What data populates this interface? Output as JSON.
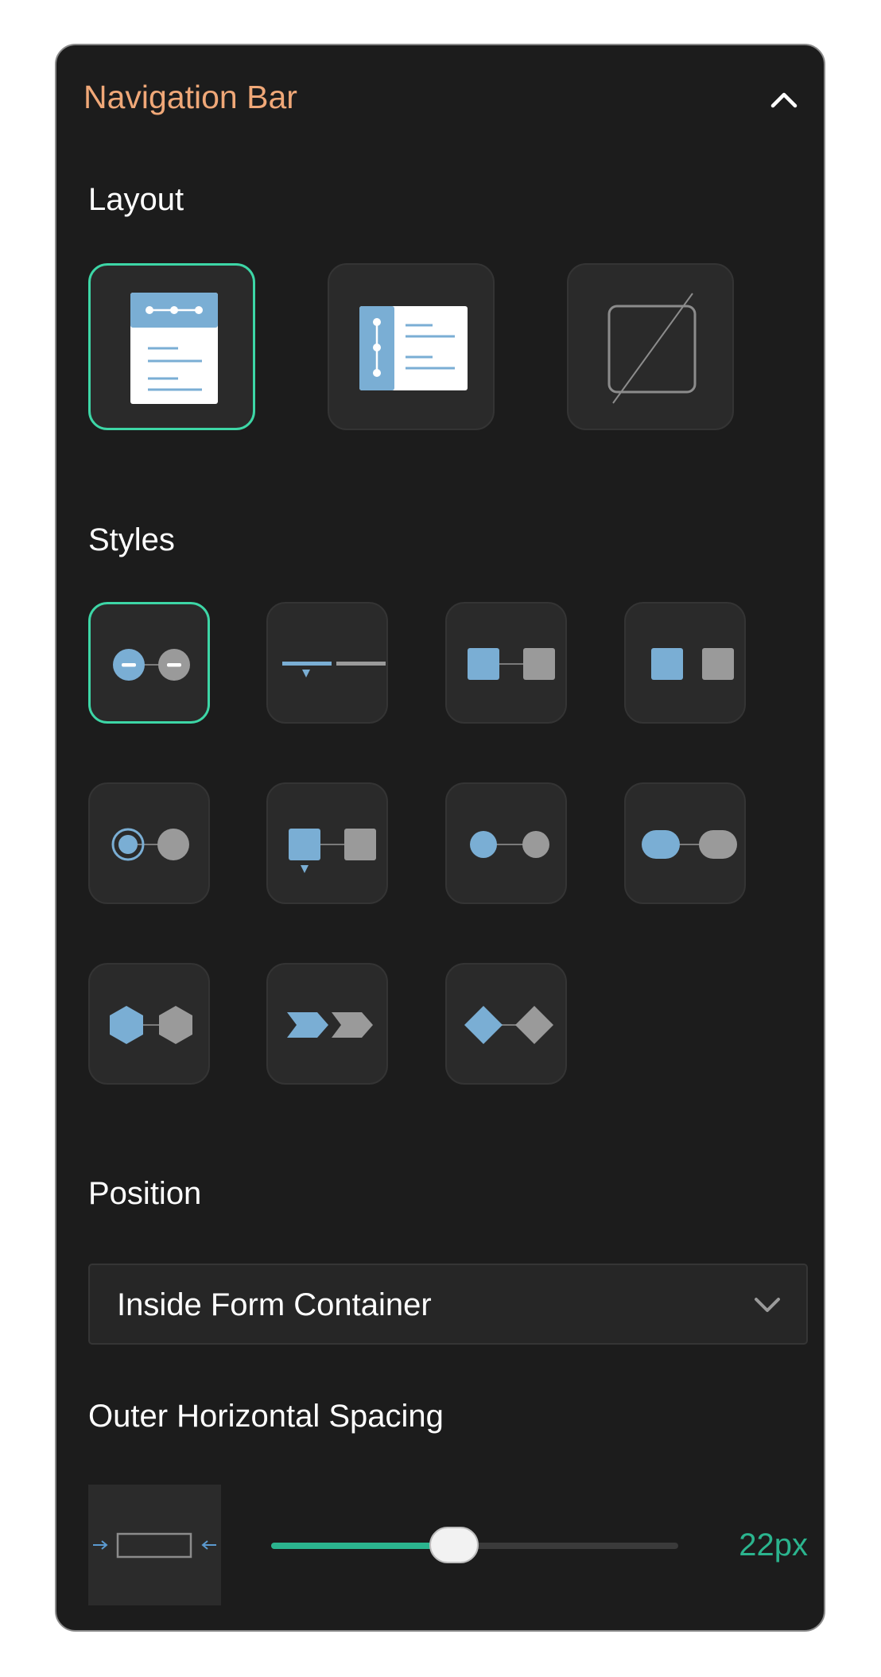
{
  "panel": {
    "title": "Navigation Bar",
    "collapse_icon": "chevron-up-icon"
  },
  "layout": {
    "label": "Layout",
    "options": [
      {
        "name": "top-bar-layout",
        "selected": true
      },
      {
        "name": "side-bar-layout",
        "selected": false
      },
      {
        "name": "no-layout",
        "selected": false
      }
    ]
  },
  "styles": {
    "label": "Styles",
    "options": [
      {
        "name": "circle-minus",
        "selected": true
      },
      {
        "name": "line-pointer",
        "selected": false
      },
      {
        "name": "square-connected",
        "selected": false
      },
      {
        "name": "square-separate",
        "selected": false
      },
      {
        "name": "ring-circle",
        "selected": false
      },
      {
        "name": "square-pointer",
        "selected": false
      },
      {
        "name": "dot-connected",
        "selected": false
      },
      {
        "name": "pill-connected",
        "selected": false
      },
      {
        "name": "hexagon",
        "selected": false
      },
      {
        "name": "chevron-arrow",
        "selected": false
      },
      {
        "name": "diamond",
        "selected": false
      }
    ]
  },
  "position": {
    "label": "Position",
    "selected": "Inside Form Container",
    "chevron_icon": "chevron-down-icon"
  },
  "spacing": {
    "label": "Outer Horizontal Spacing",
    "value_text": "22px",
    "fraction": 0.45,
    "icon": "horizontal-spacing-icon"
  },
  "colors": {
    "accent": "#3dd6a6",
    "accent_text": "#2bb48e",
    "title": "#f0a878",
    "active_shape": "#7aaed4",
    "inactive_shape": "#9a9a9a"
  }
}
